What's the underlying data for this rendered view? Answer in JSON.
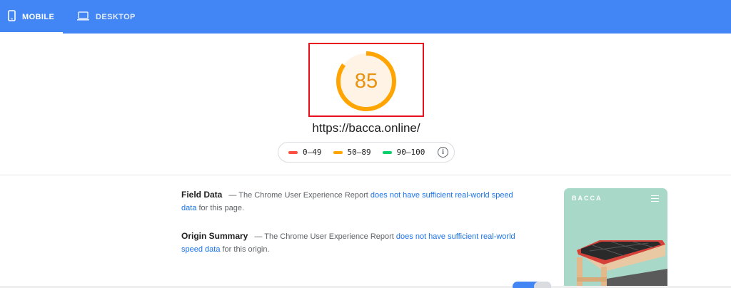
{
  "tabs": [
    {
      "label": "MOBILE",
      "icon": "smartphone-icon",
      "active": true
    },
    {
      "label": "DESKTOP",
      "icon": "laptop-icon",
      "active": false
    }
  ],
  "score": {
    "value": "85",
    "fraction": 0.85,
    "color": "#e8920d",
    "track_color": "#fff3e5"
  },
  "url": "https://bacca.online/",
  "legend": [
    {
      "range": "0–49",
      "color": "#ff4e42"
    },
    {
      "range": "50–89",
      "color": "#ffa400"
    },
    {
      "range": "90–100",
      "color": "#0cce6b"
    }
  ],
  "field_data": {
    "title": "Field Data",
    "prefix": "— The Chrome User Experience Report ",
    "link": "does not have sufficient real-world speed data",
    "suffix": " for this page."
  },
  "origin_summary": {
    "title": "Origin Summary",
    "prefix": "— The Chrome User Experience Report ",
    "link": "does not have sufficient real-world speed data",
    "suffix": " for this origin."
  },
  "thumbnail": {
    "brand": "BACCA"
  },
  "colors": {
    "header": "#4285f4",
    "link": "#1a73e8",
    "highlight": "#e8101c"
  }
}
